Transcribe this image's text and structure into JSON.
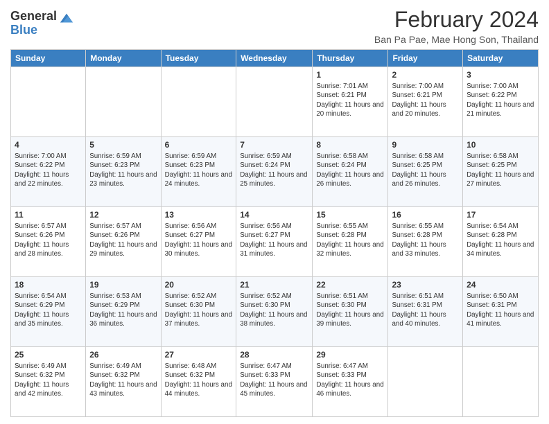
{
  "header": {
    "logo_general": "General",
    "logo_blue": "Blue",
    "month_year": "February 2024",
    "location": "Ban Pa Pae, Mae Hong Son, Thailand"
  },
  "days_of_week": [
    "Sunday",
    "Monday",
    "Tuesday",
    "Wednesday",
    "Thursday",
    "Friday",
    "Saturday"
  ],
  "weeks": [
    [
      {
        "day": "",
        "info": ""
      },
      {
        "day": "",
        "info": ""
      },
      {
        "day": "",
        "info": ""
      },
      {
        "day": "",
        "info": ""
      },
      {
        "day": "1",
        "info": "Sunrise: 7:01 AM\nSunset: 6:21 PM\nDaylight: 11 hours and 20 minutes."
      },
      {
        "day": "2",
        "info": "Sunrise: 7:00 AM\nSunset: 6:21 PM\nDaylight: 11 hours and 20 minutes."
      },
      {
        "day": "3",
        "info": "Sunrise: 7:00 AM\nSunset: 6:22 PM\nDaylight: 11 hours and 21 minutes."
      }
    ],
    [
      {
        "day": "4",
        "info": "Sunrise: 7:00 AM\nSunset: 6:22 PM\nDaylight: 11 hours and 22 minutes."
      },
      {
        "day": "5",
        "info": "Sunrise: 6:59 AM\nSunset: 6:23 PM\nDaylight: 11 hours and 23 minutes."
      },
      {
        "day": "6",
        "info": "Sunrise: 6:59 AM\nSunset: 6:23 PM\nDaylight: 11 hours and 24 minutes."
      },
      {
        "day": "7",
        "info": "Sunrise: 6:59 AM\nSunset: 6:24 PM\nDaylight: 11 hours and 25 minutes."
      },
      {
        "day": "8",
        "info": "Sunrise: 6:58 AM\nSunset: 6:24 PM\nDaylight: 11 hours and 26 minutes."
      },
      {
        "day": "9",
        "info": "Sunrise: 6:58 AM\nSunset: 6:25 PM\nDaylight: 11 hours and 26 minutes."
      },
      {
        "day": "10",
        "info": "Sunrise: 6:58 AM\nSunset: 6:25 PM\nDaylight: 11 hours and 27 minutes."
      }
    ],
    [
      {
        "day": "11",
        "info": "Sunrise: 6:57 AM\nSunset: 6:26 PM\nDaylight: 11 hours and 28 minutes."
      },
      {
        "day": "12",
        "info": "Sunrise: 6:57 AM\nSunset: 6:26 PM\nDaylight: 11 hours and 29 minutes."
      },
      {
        "day": "13",
        "info": "Sunrise: 6:56 AM\nSunset: 6:27 PM\nDaylight: 11 hours and 30 minutes."
      },
      {
        "day": "14",
        "info": "Sunrise: 6:56 AM\nSunset: 6:27 PM\nDaylight: 11 hours and 31 minutes."
      },
      {
        "day": "15",
        "info": "Sunrise: 6:55 AM\nSunset: 6:28 PM\nDaylight: 11 hours and 32 minutes."
      },
      {
        "day": "16",
        "info": "Sunrise: 6:55 AM\nSunset: 6:28 PM\nDaylight: 11 hours and 33 minutes."
      },
      {
        "day": "17",
        "info": "Sunrise: 6:54 AM\nSunset: 6:28 PM\nDaylight: 11 hours and 34 minutes."
      }
    ],
    [
      {
        "day": "18",
        "info": "Sunrise: 6:54 AM\nSunset: 6:29 PM\nDaylight: 11 hours and 35 minutes."
      },
      {
        "day": "19",
        "info": "Sunrise: 6:53 AM\nSunset: 6:29 PM\nDaylight: 11 hours and 36 minutes."
      },
      {
        "day": "20",
        "info": "Sunrise: 6:52 AM\nSunset: 6:30 PM\nDaylight: 11 hours and 37 minutes."
      },
      {
        "day": "21",
        "info": "Sunrise: 6:52 AM\nSunset: 6:30 PM\nDaylight: 11 hours and 38 minutes."
      },
      {
        "day": "22",
        "info": "Sunrise: 6:51 AM\nSunset: 6:30 PM\nDaylight: 11 hours and 39 minutes."
      },
      {
        "day": "23",
        "info": "Sunrise: 6:51 AM\nSunset: 6:31 PM\nDaylight: 11 hours and 40 minutes."
      },
      {
        "day": "24",
        "info": "Sunrise: 6:50 AM\nSunset: 6:31 PM\nDaylight: 11 hours and 41 minutes."
      }
    ],
    [
      {
        "day": "25",
        "info": "Sunrise: 6:49 AM\nSunset: 6:32 PM\nDaylight: 11 hours and 42 minutes."
      },
      {
        "day": "26",
        "info": "Sunrise: 6:49 AM\nSunset: 6:32 PM\nDaylight: 11 hours and 43 minutes."
      },
      {
        "day": "27",
        "info": "Sunrise: 6:48 AM\nSunset: 6:32 PM\nDaylight: 11 hours and 44 minutes."
      },
      {
        "day": "28",
        "info": "Sunrise: 6:47 AM\nSunset: 6:33 PM\nDaylight: 11 hours and 45 minutes."
      },
      {
        "day": "29",
        "info": "Sunrise: 6:47 AM\nSunset: 6:33 PM\nDaylight: 11 hours and 46 minutes."
      },
      {
        "day": "",
        "info": ""
      },
      {
        "day": "",
        "info": ""
      }
    ]
  ]
}
